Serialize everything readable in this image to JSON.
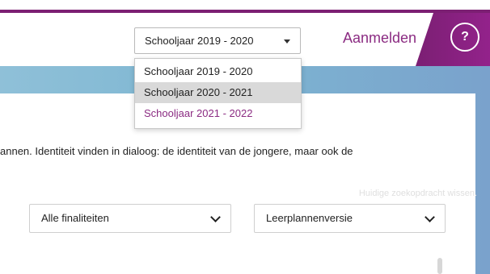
{
  "header": {
    "school_year_selected": "Schooljaar 2019 - 2020",
    "login_label": "Aanmelden",
    "help_label": "?"
  },
  "school_year_dropdown": {
    "options": [
      "Schooljaar 2019 - 2020",
      "Schooljaar 2020 - 2021",
      "Schooljaar 2021 - 2022"
    ],
    "highlighted_index": 1
  },
  "main": {
    "description": "annen. Identiteit vinden in dialoog: de identiteit van de jongere, maar ook de",
    "clear_search_label": "Huidige zoekopdracht wissen.",
    "filters": {
      "finaliteit": "Alle finaliteiten",
      "leerplanversie": "Leerplannenversie"
    }
  },
  "colors": {
    "brand": "#8b2b82",
    "band": "#7db6d2",
    "highlight": "#d9d9d9"
  }
}
